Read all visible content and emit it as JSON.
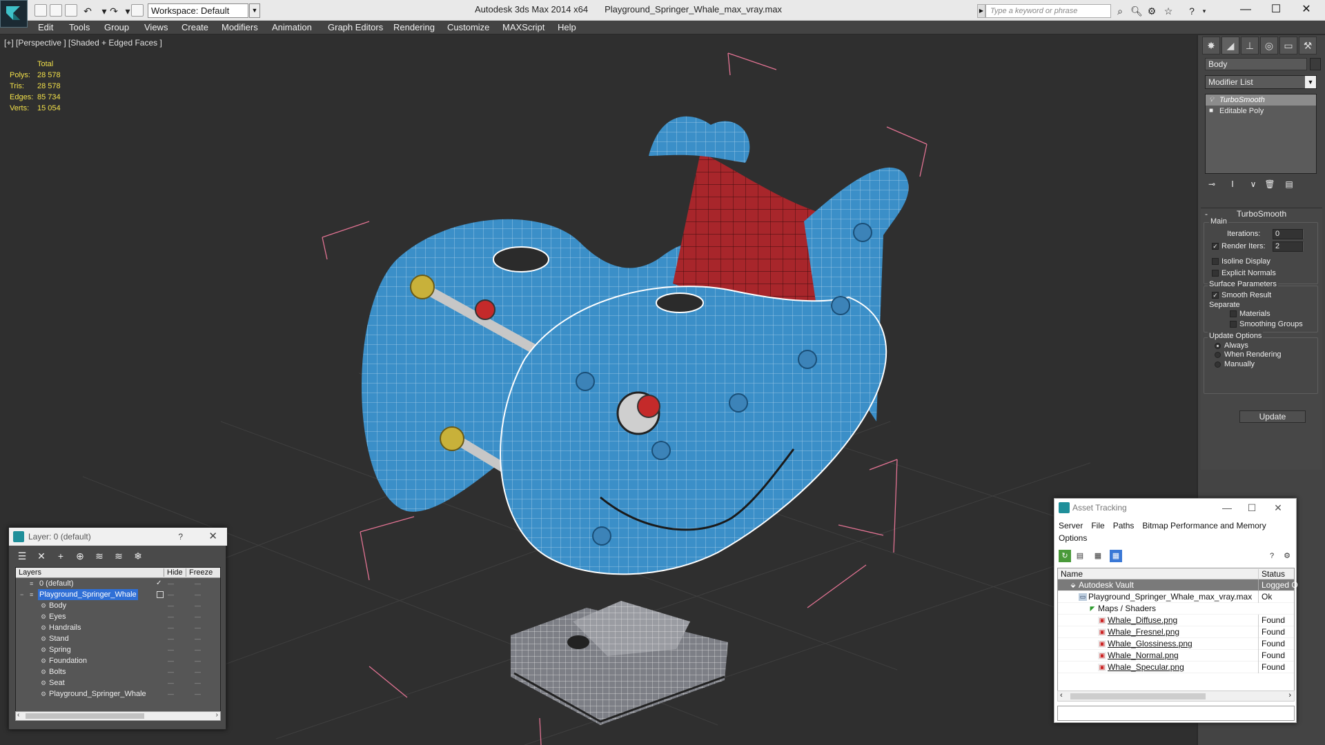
{
  "title": {
    "app": "Autodesk 3ds Max  2014 x64",
    "file": "Playground_Springer_Whale_max_vray.max",
    "workspace": "Workspace: Default",
    "search_placeholder": "Type a keyword or phrase"
  },
  "menu": [
    "Edit",
    "Tools",
    "Group",
    "Views",
    "Create",
    "Modifiers",
    "Animation",
    "Graph Editors",
    "Rendering",
    "Customize",
    "MAXScript",
    "Help"
  ],
  "viewport": {
    "label": "[+] [Perspective ] [Shaded + Edged Faces ]",
    "stats": {
      "header": "Total",
      "rows": [
        {
          "k": "Polys:",
          "v": "28 578"
        },
        {
          "k": "Tris:",
          "v": "28 578"
        },
        {
          "k": "Edges:",
          "v": "85 734"
        },
        {
          "k": "Verts:",
          "v": "15 054"
        }
      ]
    },
    "colors": {
      "body": "#3b8fc8",
      "seat": "#a8262b",
      "bolt": "#3c83b8",
      "stand": "#8d8f95",
      "handle": "#c8b13a",
      "bg": "#2f2f2f"
    }
  },
  "command_panel": {
    "object_name": "Body",
    "modifier_list": "Modifier List",
    "stack": [
      "TurboSmooth",
      "Editable Poly"
    ],
    "rollup_title": "TurboSmooth",
    "main_label": "Main",
    "iterations_label": "Iterations:",
    "iterations_value": "0",
    "render_iters_label": "Render Iters:",
    "render_iters_value": "2",
    "isoline": "Isoline Display",
    "explicit": "Explicit Normals",
    "surface_label": "Surface Parameters",
    "smooth_result": "Smooth Result",
    "separate": "Separate",
    "materials": "Materials",
    "smoothing_groups": "Smoothing Groups",
    "update_options": "Update Options",
    "always": "Always",
    "when_rendering": "When Rendering",
    "manually": "Manually",
    "update_button": "Update"
  },
  "layer_panel": {
    "title": "Layer: 0 (default)",
    "help": "?",
    "columns": {
      "layers": "Layers",
      "hide": "Hide",
      "freeze": "Freeze"
    },
    "rows": [
      "0 (default)",
      "Playground_Springer_Whale",
      "Body",
      "Eyes",
      "Handrails",
      "Stand",
      "Spring",
      "Foundation",
      "Bolts",
      "Seat",
      "Playground_Springer_Whale"
    ]
  },
  "asset_panel": {
    "title": "Asset Tracking",
    "menu": [
      "Server",
      "File",
      "Paths",
      "Bitmap Performance and Memory",
      "Options"
    ],
    "columns": {
      "name": "Name",
      "status": "Status"
    },
    "rows": [
      {
        "name": "Autodesk Vault",
        "status": "Logged O"
      },
      {
        "name": "Playground_Springer_Whale_max_vray.max",
        "status": "Ok"
      },
      {
        "name": "Maps / Shaders",
        "status": ""
      },
      {
        "name": "Whale_Diffuse.png",
        "status": "Found"
      },
      {
        "name": "Whale_Fresnel.png",
        "status": "Found"
      },
      {
        "name": "Whale_Glossiness.png",
        "status": "Found"
      },
      {
        "name": "Whale_Normal.png",
        "status": "Found"
      },
      {
        "name": "Whale_Specular.png",
        "status": "Found"
      }
    ]
  }
}
